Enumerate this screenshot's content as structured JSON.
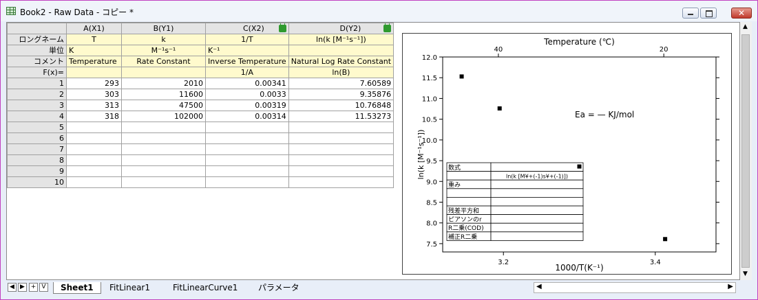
{
  "window": {
    "title": "Book2 - Raw Data - コピー *"
  },
  "columns": [
    {
      "name": "A(X1)",
      "long_name": "T",
      "units": "K",
      "comment": "Temperature",
      "formula": ""
    },
    {
      "name": "B(Y1)",
      "long_name": "k",
      "units": "M⁻¹s⁻¹",
      "comment": "Rate Constant",
      "formula": ""
    },
    {
      "name": "C(X2)",
      "long_name": "1/T",
      "units": "K⁻¹",
      "comment": "Inverse Temperature",
      "formula": "1/A"
    },
    {
      "name": "D(Y2)",
      "long_name": "ln(k [M⁻¹s⁻¹])",
      "units": "",
      "comment": "Natural Log Rate Constant",
      "formula": "ln(B)"
    }
  ],
  "row_labels": {
    "long_name": "ロングネーム",
    "units": "単位",
    "comment": "コメント",
    "formula": "F(x)="
  },
  "rows": [
    {
      "n": "1",
      "cells": [
        "293",
        "2010",
        "0.00341",
        "7.60589"
      ]
    },
    {
      "n": "2",
      "cells": [
        "303",
        "11600",
        "0.0033",
        "9.35876"
      ]
    },
    {
      "n": "3",
      "cells": [
        "313",
        "47500",
        "0.00319",
        "10.76848"
      ]
    },
    {
      "n": "4",
      "cells": [
        "318",
        "102000",
        "0.00314",
        "11.53273"
      ]
    },
    {
      "n": "5",
      "cells": [
        "",
        "",
        "",
        ""
      ]
    },
    {
      "n": "6",
      "cells": [
        "",
        "",
        "",
        ""
      ]
    },
    {
      "n": "7",
      "cells": [
        "",
        "",
        "",
        ""
      ]
    },
    {
      "n": "8",
      "cells": [
        "",
        "",
        "",
        ""
      ]
    },
    {
      "n": "9",
      "cells": [
        "",
        "",
        "",
        ""
      ]
    },
    {
      "n": "10",
      "cells": [
        "",
        "",
        "",
        ""
      ]
    }
  ],
  "sheet_tabs": [
    "Sheet1",
    "FitLinear1",
    "FitLinearCurve1",
    "パラメータ"
  ],
  "nav_buttons": [
    "◀",
    "▶",
    "+",
    "V"
  ],
  "chart_data": {
    "type": "scatter",
    "xlabel": "1000/T(K⁻¹)",
    "ylabel": "ln(k [M⁻¹s⁻¹])",
    "top_xlabel": "Temperature (℃)",
    "xlim": [
      3.12,
      3.48
    ],
    "ylim": [
      7.3,
      12.0
    ],
    "x_ticks": [
      "3.2",
      "3.4"
    ],
    "y_ticks": [
      "7.5",
      "8.0",
      "8.5",
      "9.0",
      "9.5",
      "10.0",
      "10.5",
      "11.0",
      "11.5",
      "12.0"
    ],
    "top_ticks": [
      "40",
      "20"
    ],
    "points": [
      {
        "x": 3.145,
        "y": 11.53
      },
      {
        "x": 3.195,
        "y": 10.76
      },
      {
        "x": 3.3,
        "y": 9.36
      },
      {
        "x": 3.413,
        "y": 7.61
      }
    ],
    "annotation": "Ea = — KJ/mol",
    "fit_table": [
      [
        "数式",
        ""
      ],
      [
        "",
        "ln(k [M¥+(-1)s¥+(-1)])"
      ],
      [
        "重み",
        ""
      ],
      [
        "",
        ""
      ],
      [
        "",
        ""
      ],
      [
        "残差平方和",
        ""
      ],
      [
        "ピアソンのr",
        ""
      ],
      [
        "R二乗(COD)",
        ""
      ],
      [
        "補正R二乗",
        ""
      ]
    ],
    "grid": false
  }
}
